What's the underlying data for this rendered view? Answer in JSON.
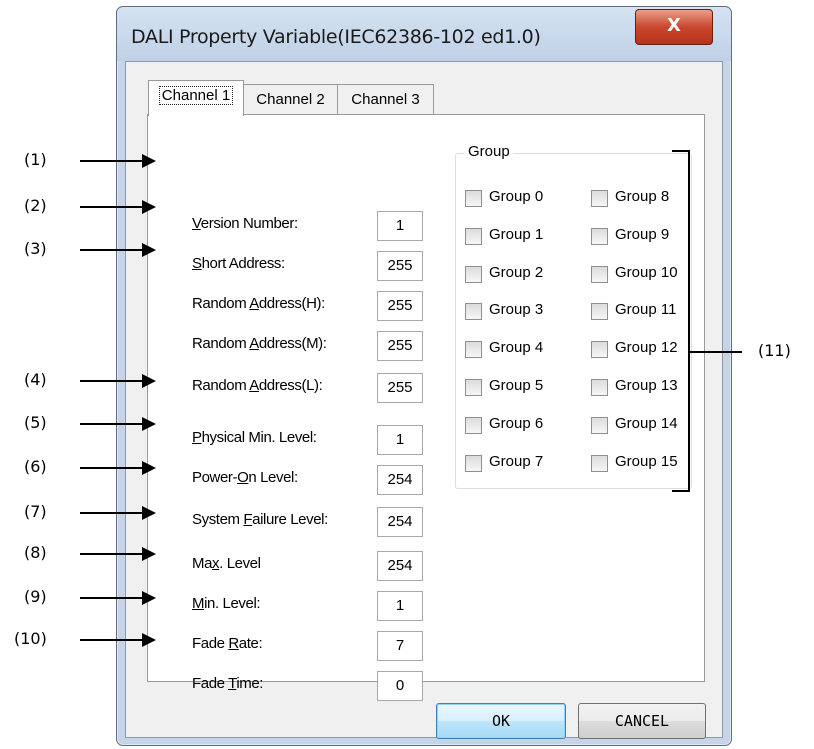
{
  "window": {
    "title": "DALI Property Variable(IEC62386-102 ed1.0)",
    "close_label": "X"
  },
  "tabs": [
    "Channel 1",
    "Channel 2",
    "Channel 3"
  ],
  "fields": [
    {
      "pre": "",
      "key": "V",
      "post": "ersion Number:",
      "value": "1"
    },
    {
      "pre": "",
      "key": "S",
      "post": "hort Address:",
      "value": "255"
    },
    {
      "pre": "Random ",
      "key": "A",
      "post": "ddress(H):",
      "value": "255"
    },
    {
      "pre": "Random ",
      "key": "A",
      "post": "ddress(M):",
      "value": "255"
    },
    {
      "pre": "Random ",
      "key": "A",
      "post": "ddress(L):",
      "value": "255"
    },
    {
      "pre": "",
      "key": "P",
      "post": "hysical Min. Level:",
      "value": "1"
    },
    {
      "pre": "Power-",
      "key": "O",
      "post": "n Level:",
      "value": "254"
    },
    {
      "pre": "System ",
      "key": "F",
      "post": "ailure Level:",
      "value": "254"
    },
    {
      "pre": "Ma",
      "key": "x",
      "post": ". Level",
      "value": "254"
    },
    {
      "pre": "",
      "key": "M",
      "post": "in. Level:",
      "value": "1"
    },
    {
      "pre": "Fade ",
      "key": "R",
      "post": "ate:",
      "value": "7"
    },
    {
      "pre": "Fade ",
      "key": "T",
      "post": "ime:",
      "value": "0"
    }
  ],
  "group": {
    "title": "Group",
    "items": [
      "Group 0",
      "Group 1",
      "Group 2",
      "Group 3",
      "Group 4",
      "Group 5",
      "Group 6",
      "Group 7",
      "Group 8",
      "Group 9",
      "Group 10",
      "Group 11",
      "Group 12",
      "Group 13",
      "Group 14",
      "Group 15"
    ]
  },
  "buttons": {
    "ok": "OK",
    "cancel": "CANCEL"
  },
  "annotations": [
    "(1)",
    "(2)",
    "(3)",
    "(4)",
    "(5)",
    "(6)",
    "(7)",
    "(8)",
    "(9)",
    "(10)",
    "(11)"
  ]
}
